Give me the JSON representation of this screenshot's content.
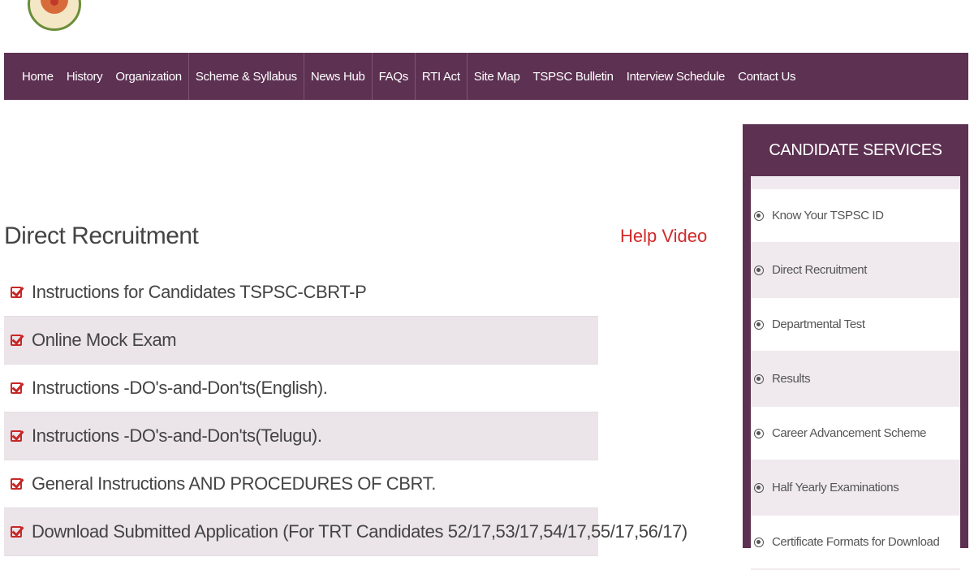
{
  "nav": {
    "items": [
      {
        "label": "Home"
      },
      {
        "label": "History"
      },
      {
        "label": "Organization"
      },
      {
        "label": "Scheme & Syllabus"
      },
      {
        "label": "News Hub"
      },
      {
        "label": "FAQs"
      },
      {
        "label": "RTI Act"
      },
      {
        "label": "Site Map"
      },
      {
        "label": "TSPSC Bulletin"
      },
      {
        "label": "Interview Schedule"
      },
      {
        "label": "Contact Us"
      }
    ]
  },
  "main": {
    "title": "Direct Recruitment",
    "help_video": "Help Video",
    "links": [
      {
        "label": "Instructions for Candidates TSPSC-CBRT-P"
      },
      {
        "label": "Online Mock Exam"
      },
      {
        "label": "Instructions -DO's-and-Don'ts(English)."
      },
      {
        "label": "Instructions -DO's-and-Don'ts(Telugu)."
      },
      {
        "label": "General Instructions AND PROCEDURES OF CBRT."
      },
      {
        "label": "Download Submitted Application (For TRT Candidates 52/17,53/17,54/17,55/17,56/17)"
      }
    ]
  },
  "sidebar": {
    "title": "CANDIDATE SERVICES",
    "items": [
      {
        "label": "Know Your TSPSC ID"
      },
      {
        "label": "Direct Recruitment"
      },
      {
        "label": "Departmental Test"
      },
      {
        "label": "Results"
      },
      {
        "label": "Career Advancement Scheme"
      },
      {
        "label": "Half Yearly Examinations"
      },
      {
        "label": "Certificate Formats for Download"
      }
    ]
  },
  "colors": {
    "nav_bg": "#5d3152",
    "accent_red": "#d12b2b",
    "row_alt": "#ebe4e8"
  },
  "icons": {
    "logo": "tspsc-emblem-icon",
    "link_bullet": "checkbox-checked-icon",
    "service_bullet": "circle-bullet-icon"
  }
}
